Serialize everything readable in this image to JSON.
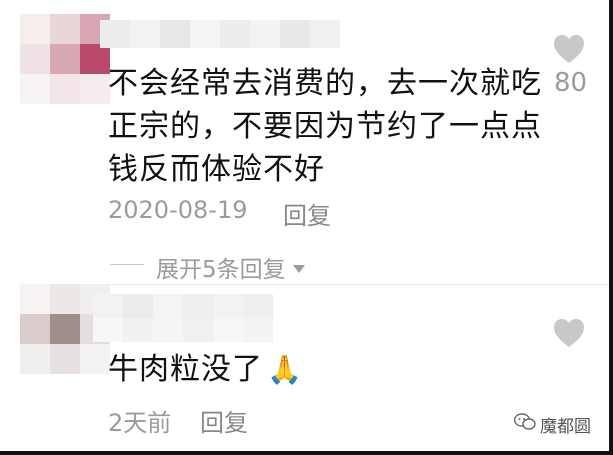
{
  "comments": [
    {
      "text_line1": "不会经常去消费的，去一次就吃",
      "text_line2": "正宗的，不要因为节约了一点点",
      "text_line3": "钱反而体验不好",
      "date": "2020-08-19",
      "reply_label": "回复",
      "likes": "80",
      "expand_label": "展开5条回复"
    },
    {
      "text": "牛肉粒没了",
      "emoji": "🙏",
      "date": "2天前",
      "reply_label": "回复"
    }
  ],
  "watermark": "魔都圆",
  "colors": {
    "text": "#111111",
    "meta": "#9b9b9b",
    "heart": "#c8c8c8"
  },
  "icons": [
    "heart-icon",
    "caret-down-icon",
    "wechat-icon"
  ]
}
